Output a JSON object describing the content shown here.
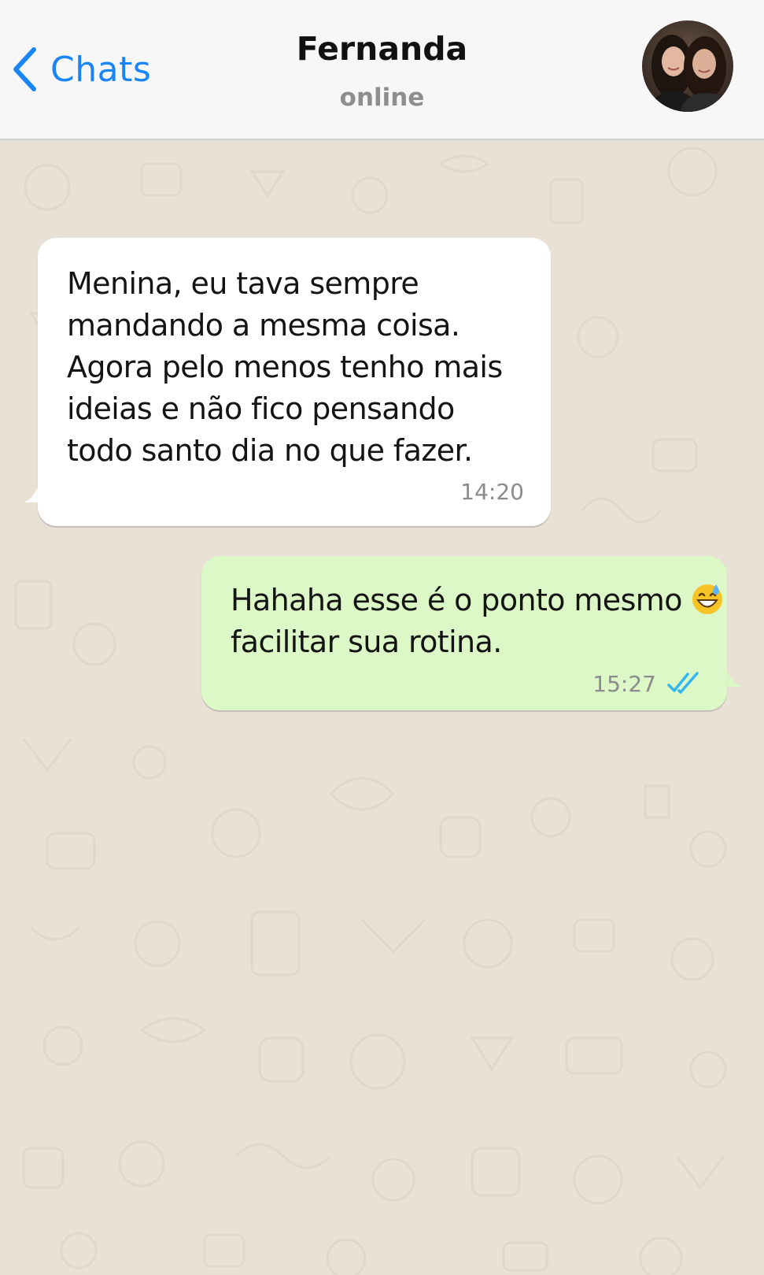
{
  "header": {
    "back_label": "Chats",
    "contact_name": "Fernanda",
    "status": "online"
  },
  "messages": [
    {
      "direction": "incoming",
      "text": "Menina, eu tava sempre\nmandando a mesma coisa.\nAgora pelo menos tenho mais\nideias e não fico pensando\ntodo santo dia no que fazer.",
      "time": "14:20"
    },
    {
      "direction": "outgoing",
      "text_line1": "Hahaha esse é o ponto mesmo ",
      "text_line2": "facilitar sua rotina.",
      "emoji": "grinning-face-with-sweat",
      "time": "15:27",
      "status_icon": "double-check-read"
    }
  ],
  "colors": {
    "accent": "#1a86f5",
    "header_bg": "#f7f7f7",
    "chat_bg": "#e9e1d6",
    "incoming_bubble": "#ffffff",
    "outgoing_bubble": "#dcf8c6",
    "read_tick": "#34b7f1"
  }
}
